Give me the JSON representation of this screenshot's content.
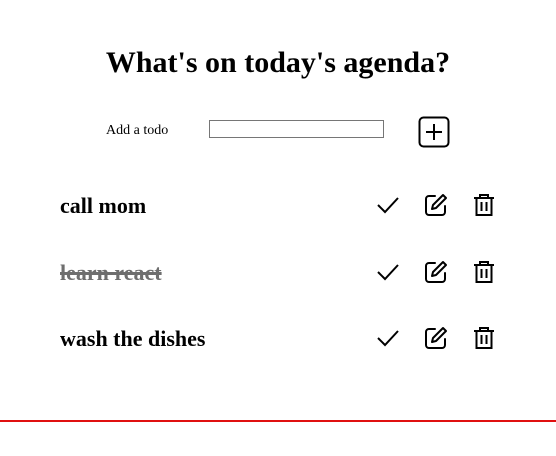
{
  "header": {
    "title": "What's on today's agenda?"
  },
  "add_form": {
    "label": "Add a todo",
    "input_value": "",
    "button_icon": "plus-square-icon"
  },
  "todos": [
    {
      "text": "call mom",
      "completed": false
    },
    {
      "text": "learn react",
      "completed": true
    },
    {
      "text": "wash the dishes",
      "completed": false
    }
  ],
  "actions": {
    "complete_icon": "check-icon",
    "edit_icon": "edit-icon",
    "delete_icon": "trash-icon"
  },
  "colors": {
    "divider": "#e01010",
    "completed_text": "#6e6e6e"
  }
}
